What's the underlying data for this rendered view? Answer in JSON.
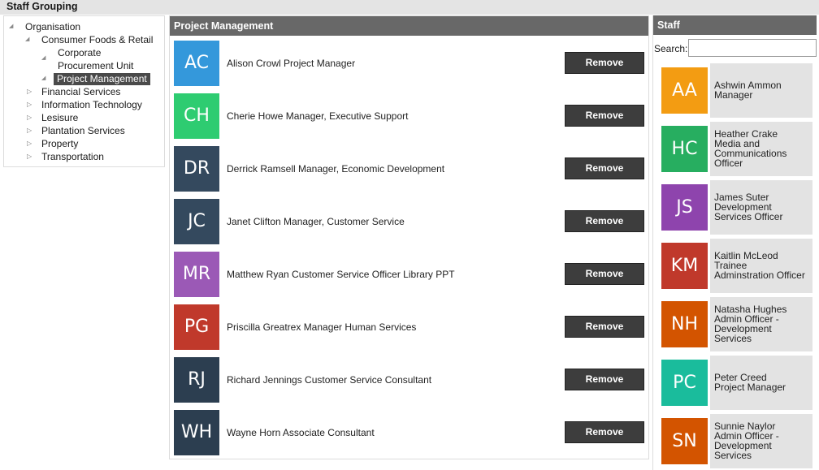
{
  "app": {
    "title": "Staff Grouping"
  },
  "tree": {
    "nodes": [
      {
        "label": "Organisation",
        "state": "expanded"
      },
      {
        "label": "Consumer Foods & Retail",
        "state": "expanded"
      },
      {
        "label": "Corporate",
        "label2": "Procurement Unit",
        "state": "expanded"
      },
      {
        "label": "Project Management",
        "state": "expanded",
        "selected": true
      },
      {
        "label": "Financial Services",
        "state": "collapsed"
      },
      {
        "label": "Information Technology",
        "state": "collapsed"
      },
      {
        "label": "Lesisure",
        "state": "collapsed"
      },
      {
        "label": "Plantation Services",
        "state": "collapsed"
      },
      {
        "label": "Property",
        "state": "collapsed"
      },
      {
        "label": "Transportation",
        "state": "collapsed"
      }
    ]
  },
  "group": {
    "title": "Project Management",
    "remove_label": "Remove",
    "members": [
      {
        "initials": "AC",
        "name": "Alison Crowl Project Manager",
        "color": "#3498db"
      },
      {
        "initials": "CH",
        "name": "Cherie Howe Manager, Executive Support",
        "color": "#2ecc71"
      },
      {
        "initials": "DR",
        "name": "Derrick Ramsell Manager, Economic Development",
        "color": "#34495e"
      },
      {
        "initials": "JC",
        "name": "Janet Clifton Manager, Customer Service",
        "color": "#34495e"
      },
      {
        "initials": "MR",
        "name": "Matthew Ryan Customer Service Officer Library PPT",
        "color": "#9b59b6"
      },
      {
        "initials": "PG",
        "name": "Priscilla Greatrex Manager Human Services",
        "color": "#c0392b"
      },
      {
        "initials": "RJ",
        "name": "Richard Jennings Customer Service Consultant",
        "color": "#2c3e50"
      },
      {
        "initials": "WH",
        "name": "Wayne Horn Associate Consultant",
        "color": "#2c3e50"
      }
    ]
  },
  "staff": {
    "title": "Staff",
    "search_label": "Search:",
    "search_value": "",
    "people": [
      {
        "initials": "AA",
        "lines": [
          "Ashwin Ammon",
          "Manager"
        ],
        "color": "#f39c12"
      },
      {
        "initials": "HC",
        "lines": [
          "Heather Crake",
          "Media and",
          "Communications",
          "Officer"
        ],
        "color": "#27ae60"
      },
      {
        "initials": "JS",
        "lines": [
          "James Suter",
          "Development",
          "Services Officer"
        ],
        "color": "#8e44ad"
      },
      {
        "initials": "KM",
        "lines": [
          "Kaitlin McLeod",
          "Trainee",
          "Adminstration Officer"
        ],
        "color": "#c0392b"
      },
      {
        "initials": "NH",
        "lines": [
          "Natasha Hughes",
          "Admin Officer -",
          "Development",
          "Services"
        ],
        "color": "#d35400"
      },
      {
        "initials": "PC",
        "lines": [
          "Peter Creed",
          "Project Manager"
        ],
        "color": "#1abc9c"
      },
      {
        "initials": "SN",
        "lines": [
          "Sunnie Naylor",
          "Admin Officer -",
          "Development",
          "Services"
        ],
        "color": "#d35400"
      }
    ]
  }
}
